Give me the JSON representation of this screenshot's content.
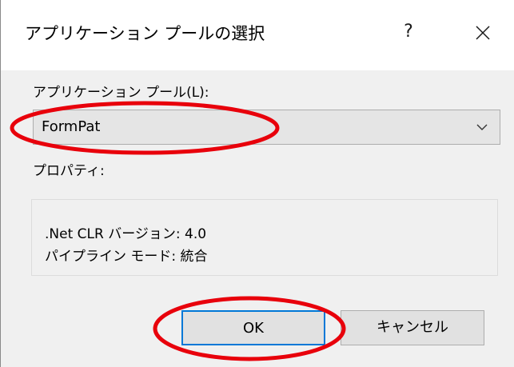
{
  "window": {
    "title": "アプリケーション プールの選択",
    "help_glyph": "?",
    "close_icon": "close-icon"
  },
  "pool": {
    "label": "アプリケーション プール(L):",
    "selected": "FormPat",
    "dropdown_icon": "chevron-down-icon"
  },
  "properties": {
    "label": "プロパティ:",
    "lines": [
      ".Net CLR バージョン: 4.0",
      "パイプライン モード: 統合"
    ]
  },
  "buttons": {
    "ok": "OK",
    "cancel": "キャンセル"
  },
  "colors": {
    "annotation": "#e8000b",
    "focus_border": "#0078d7",
    "window_bg": "#f0f0f0",
    "titlebar_bg": "#ffffff"
  }
}
